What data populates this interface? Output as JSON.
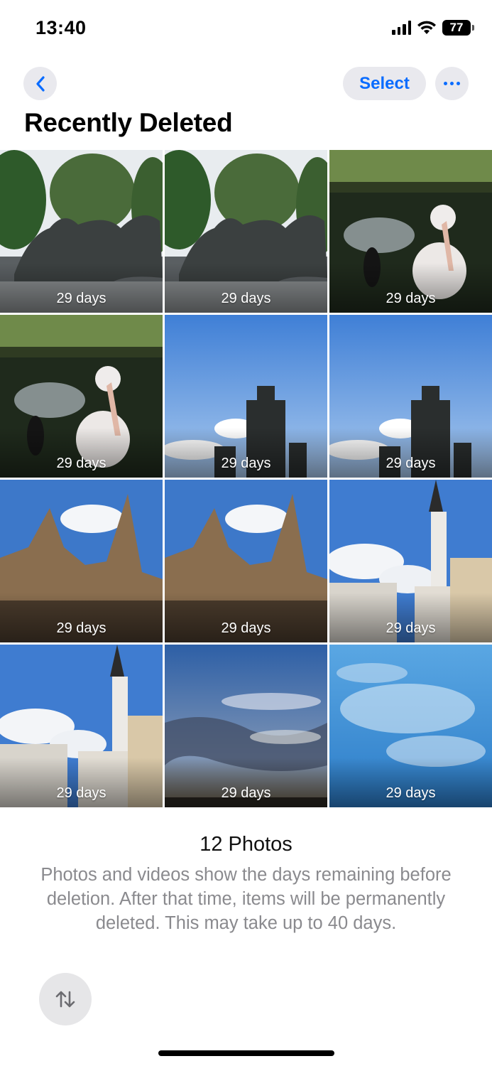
{
  "status_bar": {
    "time": "13:40",
    "battery": "77",
    "icons": [
      "signal-icon",
      "wifi-icon",
      "battery-icon"
    ]
  },
  "nav": {
    "back_icon": "chevron-left-icon",
    "select_label": "Select",
    "more_icon": "ellipsis-icon"
  },
  "page": {
    "title": "Recently Deleted"
  },
  "photos": [
    {
      "days": "29 days",
      "scene": "lion-statue"
    },
    {
      "days": "29 days",
      "scene": "lion-statue"
    },
    {
      "days": "29 days",
      "scene": "pelican-pond"
    },
    {
      "days": "29 days",
      "scene": "pelican-pond"
    },
    {
      "days": "29 days",
      "scene": "monument-sky"
    },
    {
      "days": "29 days",
      "scene": "monument-sky"
    },
    {
      "days": "29 days",
      "scene": "cathedral"
    },
    {
      "days": "29 days",
      "scene": "cathedral"
    },
    {
      "days": "29 days",
      "scene": "church-tower"
    },
    {
      "days": "29 days",
      "scene": "church-tower"
    },
    {
      "days": "29 days",
      "scene": "cloudy-dusk-sky"
    },
    {
      "days": "29 days",
      "scene": "blue-cloud-sky"
    }
  ],
  "footer": {
    "count": "12 Photos",
    "note": "Photos and videos show the days remaining before deletion. After that time, items will be permanently deleted. This may take up to 40 days.",
    "sort_icon": "sort-arrows-icon"
  },
  "colors": {
    "accent": "#0a6cff",
    "button_bg": "#e9e9ee",
    "secondary_text": "#8a8a8e"
  }
}
